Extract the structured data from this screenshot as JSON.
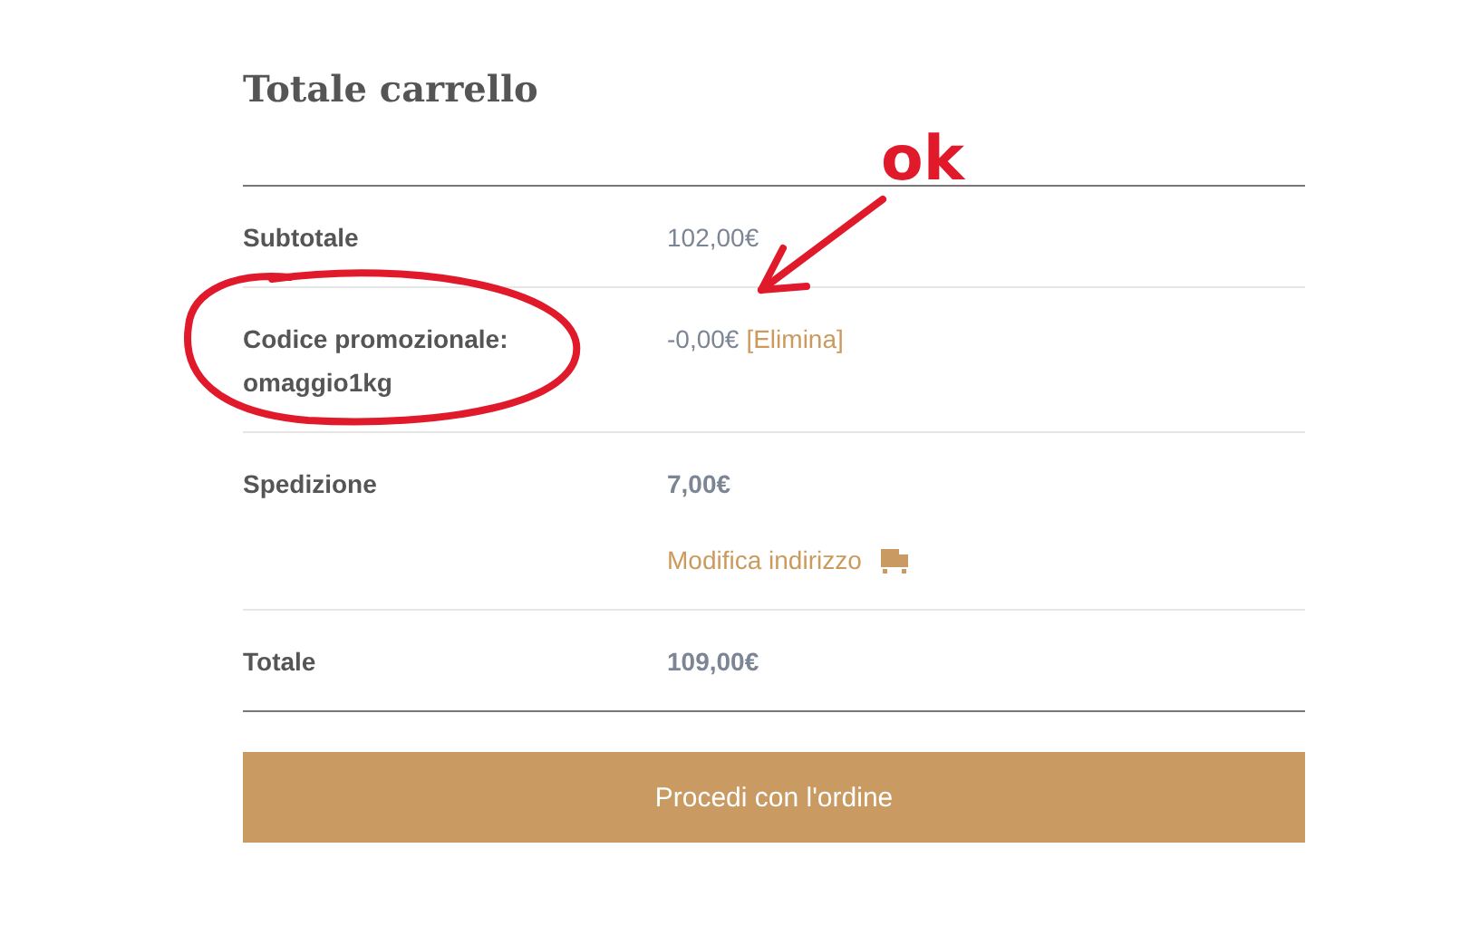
{
  "title": "Totale carrello",
  "rows": [
    {
      "label": "Subtotale",
      "value": "102,00€",
      "bold": false
    },
    {
      "label": "Codice promozionale: omaggio1kg",
      "value": "-0,00€",
      "bold": false,
      "link": "[Elimina]"
    },
    {
      "label": "Spedizione",
      "value": "7,00€",
      "bold": true,
      "link_below": "Modifica indirizzo"
    },
    {
      "label": "Totale",
      "value": "109,00€",
      "bold": true
    }
  ],
  "button": "Procedi con l'ordine",
  "annotation": {
    "label": "ok"
  }
}
